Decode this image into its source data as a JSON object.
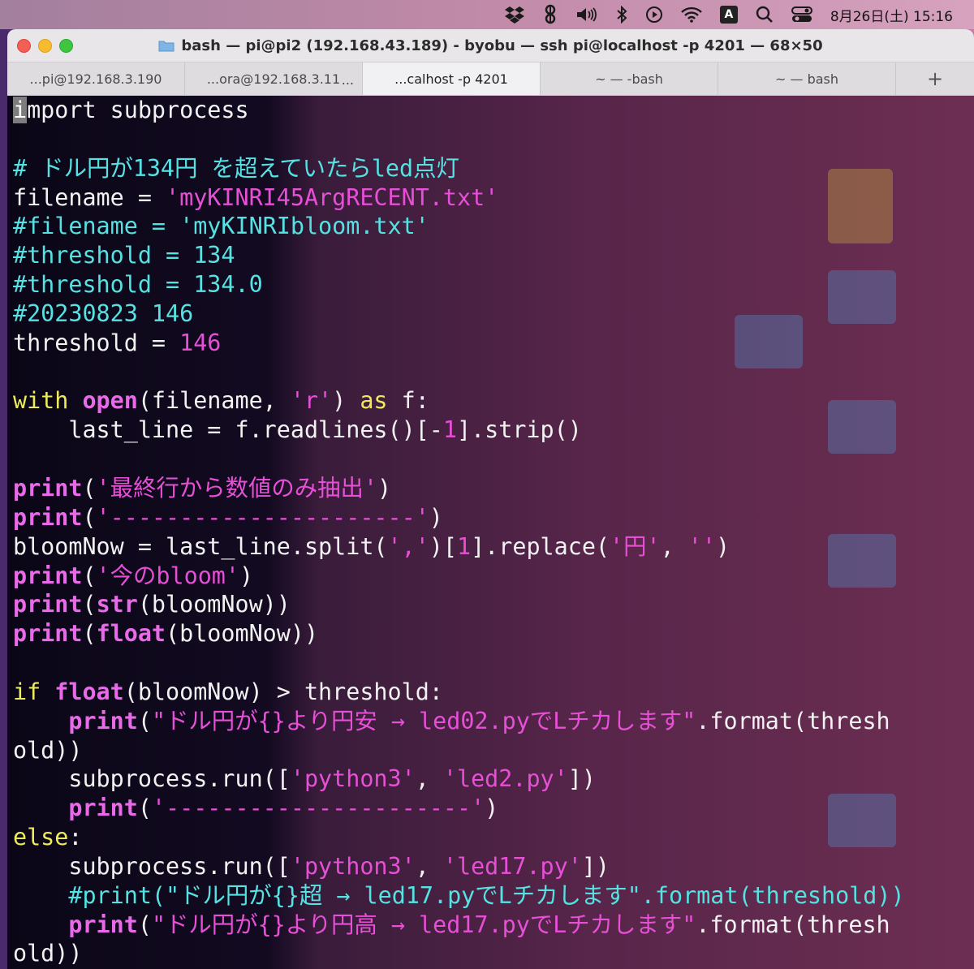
{
  "menubar": {
    "items": [
      "dropbox-icon",
      "evernote-icon",
      "volume-icon",
      "bluetooth-icon",
      "play-icon",
      "wifi-icon",
      "input-source",
      "search-icon",
      "control-center-icon"
    ],
    "input_source_label": "A",
    "clock": "8月26日(土) 15:16"
  },
  "window": {
    "title": "bash — pi@pi2 (192.168.43.189) - byobu — ssh pi@localhost -p 4201 — 68×50",
    "tabs": [
      {
        "label": "...pi@192.168.3.190",
        "active": false
      },
      {
        "label": "...ora@192.168.3.11",
        "active": false,
        "extra": "..."
      },
      {
        "label": "...calhost -p 4201",
        "active": true
      },
      {
        "label": "~ — -bash",
        "active": false
      },
      {
        "label": "~ — bash",
        "active": false
      }
    ],
    "add_tab_label": "+"
  },
  "code": {
    "lines": [
      [
        {
          "t": "i",
          "c": "cursor"
        },
        {
          "t": "mport subprocess"
        }
      ],
      [],
      [
        {
          "t": "# ドル円が134円 を超えていたらled点灯",
          "c": "comment"
        }
      ],
      [
        {
          "t": "filename = "
        },
        {
          "t": "'myKINRI45ArgRECENT.txt'",
          "c": "str"
        }
      ],
      [
        {
          "t": "#filename = 'myKINRIbloom.txt'",
          "c": "comment"
        }
      ],
      [
        {
          "t": "#threshold = 134",
          "c": "comment"
        }
      ],
      [
        {
          "t": "#threshold = 134.0",
          "c": "comment"
        }
      ],
      [
        {
          "t": "#20230823 146",
          "c": "comment"
        }
      ],
      [
        {
          "t": "threshold = "
        },
        {
          "t": "146",
          "c": "num"
        }
      ],
      [],
      [
        {
          "t": "with",
          "c": "kw-yellow"
        },
        {
          "t": " "
        },
        {
          "t": "open",
          "c": "kw-bold"
        },
        {
          "t": "(filename, "
        },
        {
          "t": "'r'",
          "c": "str"
        },
        {
          "t": ") "
        },
        {
          "t": "as",
          "c": "kw-yellow"
        },
        {
          "t": " f:"
        }
      ],
      [
        {
          "t": "    last_line = f.readlines()[-"
        },
        {
          "t": "1",
          "c": "num"
        },
        {
          "t": "].strip()"
        }
      ],
      [],
      [
        {
          "t": "print",
          "c": "kw-bold"
        },
        {
          "t": "("
        },
        {
          "t": "'最終行から数値のみ抽出'",
          "c": "str"
        },
        {
          "t": ")"
        }
      ],
      [
        {
          "t": "print",
          "c": "kw-bold"
        },
        {
          "t": "("
        },
        {
          "t": "'----------------------'",
          "c": "str"
        },
        {
          "t": ")"
        }
      ],
      [
        {
          "t": "bloomNow = last_line.split("
        },
        {
          "t": "','",
          "c": "str"
        },
        {
          "t": ")["
        },
        {
          "t": "1",
          "c": "num"
        },
        {
          "t": "].replace("
        },
        {
          "t": "'円'",
          "c": "str"
        },
        {
          "t": ", "
        },
        {
          "t": "''",
          "c": "str"
        },
        {
          "t": ")"
        }
      ],
      [
        {
          "t": "print",
          "c": "kw-bold"
        },
        {
          "t": "("
        },
        {
          "t": "'今のbloom'",
          "c": "str"
        },
        {
          "t": ")"
        }
      ],
      [
        {
          "t": "print",
          "c": "kw-bold"
        },
        {
          "t": "("
        },
        {
          "t": "str",
          "c": "kw-bold"
        },
        {
          "t": "(bloomNow))"
        }
      ],
      [
        {
          "t": "print",
          "c": "kw-bold"
        },
        {
          "t": "("
        },
        {
          "t": "float",
          "c": "kw-bold"
        },
        {
          "t": "(bloomNow))"
        }
      ],
      [],
      [
        {
          "t": "if",
          "c": "kw-yellow"
        },
        {
          "t": " "
        },
        {
          "t": "float",
          "c": "kw-bold"
        },
        {
          "t": "(bloomNow) > threshold:"
        }
      ],
      [
        {
          "t": "    "
        },
        {
          "t": "print",
          "c": "kw-bold"
        },
        {
          "t": "("
        },
        {
          "t": "\"ドル円が{}より円安 → led02.pyでLチカします\"",
          "c": "str"
        },
        {
          "t": ".format(thresh"
        }
      ],
      [
        {
          "t": "old))"
        }
      ],
      [
        {
          "t": "    subprocess.run(["
        },
        {
          "t": "'python3'",
          "c": "str"
        },
        {
          "t": ", "
        },
        {
          "t": "'led2.py'",
          "c": "str"
        },
        {
          "t": "])"
        }
      ],
      [
        {
          "t": "    "
        },
        {
          "t": "print",
          "c": "kw-bold"
        },
        {
          "t": "("
        },
        {
          "t": "'----------------------'",
          "c": "str"
        },
        {
          "t": ")"
        }
      ],
      [
        {
          "t": "else",
          "c": "kw-yellow"
        },
        {
          "t": ":"
        }
      ],
      [
        {
          "t": "    subprocess.run(["
        },
        {
          "t": "'python3'",
          "c": "str"
        },
        {
          "t": ", "
        },
        {
          "t": "'led17.py'",
          "c": "str"
        },
        {
          "t": "])"
        }
      ],
      [
        {
          "t": "    #print(\"ドル円が{}超 → led17.pyでLチカします\".format(threshold))",
          "c": "comment"
        }
      ],
      [
        {
          "t": "    "
        },
        {
          "t": "print",
          "c": "kw-bold"
        },
        {
          "t": "("
        },
        {
          "t": "\"ドル円が{}より円高 → led17.pyでLチカします\"",
          "c": "str"
        },
        {
          "t": ".format(thresh"
        }
      ],
      [
        {
          "t": "old))"
        }
      ]
    ]
  },
  "colors": {
    "comment": "#56e2e2",
    "string": "#e64fd6",
    "keyword_bold": "#e86ae8",
    "keyword": "#ecec5b",
    "text": "#f2f2f2"
  }
}
